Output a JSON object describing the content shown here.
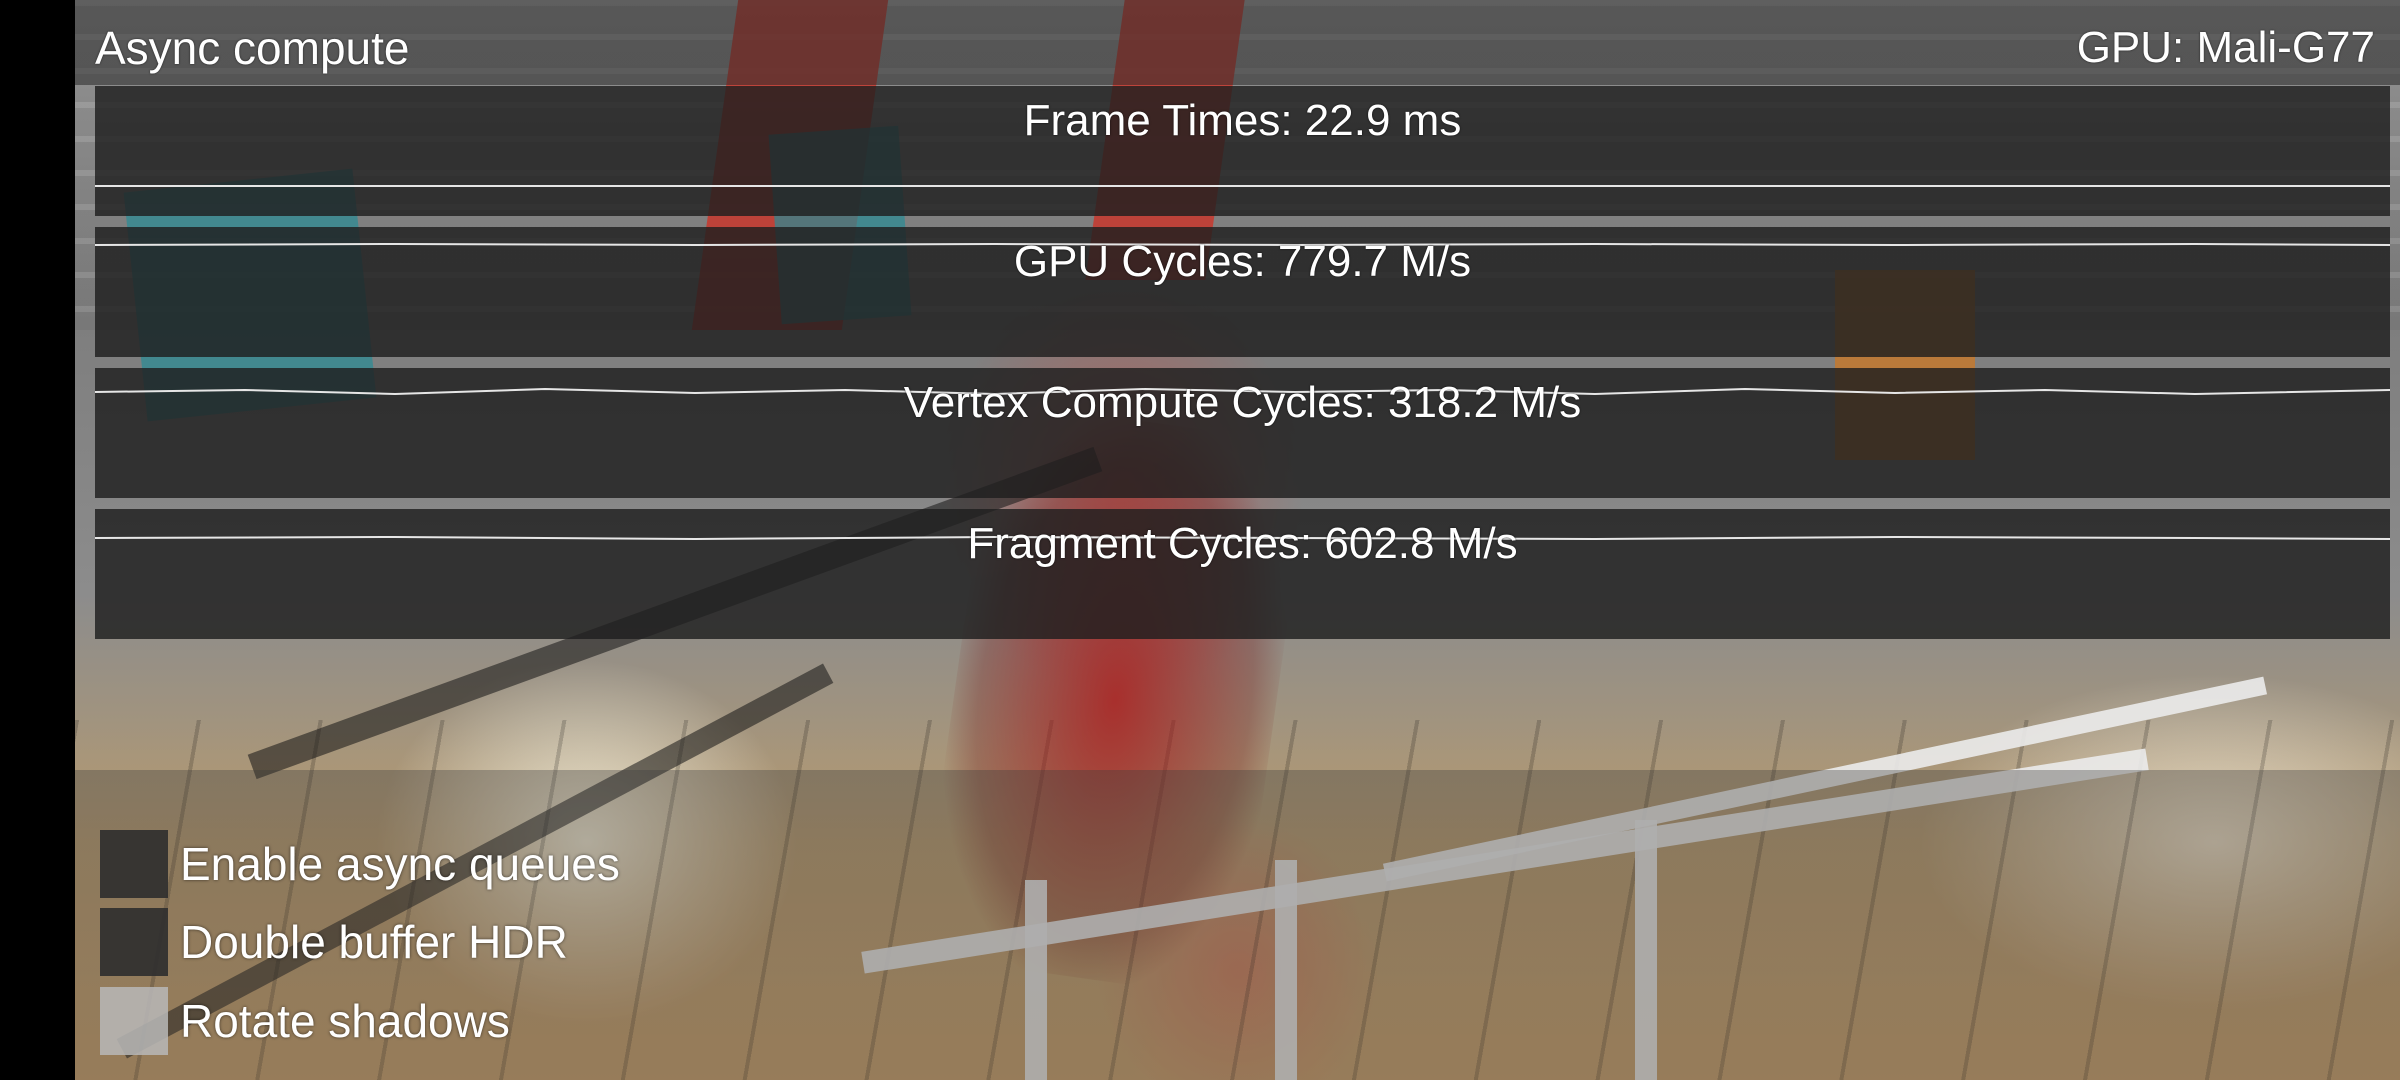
{
  "header": {
    "title": "Async compute",
    "gpu": "GPU: Mali-G77"
  },
  "graphs": [
    {
      "label": "Frame Times: 22.9 ms"
    },
    {
      "label": "GPU Cycles: 779.7 M/s"
    },
    {
      "label": "Vertex Compute Cycles: 318.2 M/s"
    },
    {
      "label": "Fragment Cycles: 602.8 M/s"
    }
  ],
  "options": [
    {
      "label": "Enable async queues",
      "checked": false
    },
    {
      "label": "Double buffer HDR",
      "checked": false
    },
    {
      "label": "Rotate shadows",
      "checked": true
    }
  ]
}
